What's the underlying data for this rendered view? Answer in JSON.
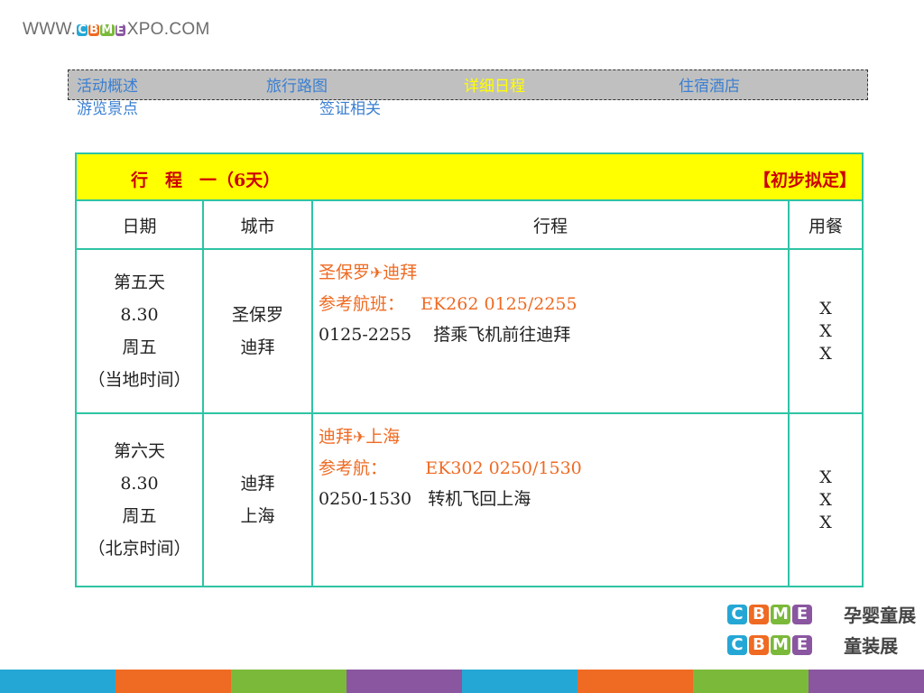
{
  "header": {
    "url_prefix": "WWW.",
    "logo_letters": [
      "C",
      "B",
      "M",
      "E"
    ],
    "url_suffix": "XPO.COM"
  },
  "nav": {
    "items": [
      {
        "label": "活动概述",
        "active": false
      },
      {
        "label": "旅行路图",
        "active": false
      },
      {
        "label": "详细日程",
        "active": true
      },
      {
        "label": "住宿酒店",
        "active": false
      },
      {
        "label": "游览景点",
        "active": false
      },
      {
        "label": "签证相关",
        "active": false
      }
    ]
  },
  "schedule": {
    "title": "行　程　一（6天）",
    "tag": "【初步拟定】",
    "columns": [
      "日期",
      "城市",
      "行程",
      "用餐"
    ],
    "rows": [
      {
        "date_lines": [
          "第五天",
          "8.30",
          "周五",
          "（当地时间）"
        ],
        "city_lines": [
          "圣保罗",
          "迪拜"
        ],
        "route_from": "圣保罗",
        "route_to": "迪拜",
        "flight": "参考航班：   EK262 0125/2255",
        "detail": "0125-2255    搭乘飞机前往迪拜",
        "meals": [
          "X",
          "X",
          "X"
        ]
      },
      {
        "date_lines": [
          "第六天",
          "8.30",
          "周五",
          "（北京时间）"
        ],
        "city_lines": [
          "迪拜",
          "上海"
        ],
        "route_from": "迪拜",
        "route_to": "上海",
        "flight": "参考航：       EK302 0250/1530",
        "detail": "0250-1530   转机飞回上海",
        "meals": [
          "X",
          "X",
          "X"
        ]
      }
    ]
  },
  "brand": {
    "letters": [
      "C",
      "B",
      "M",
      "E"
    ],
    "line1": "孕婴童展",
    "line2": "童装展",
    "reg_mark": "®"
  },
  "colors": {
    "logo": [
      "#25a7d5",
      "#ef6a22",
      "#7bb93a",
      "#8a56a0"
    ],
    "stripes": [
      "#25a7d5",
      "#ef6a22",
      "#7bb93a",
      "#8a56a0",
      "#25a7d5",
      "#ef6a22",
      "#7bb93a",
      "#8a56a0"
    ]
  },
  "icons": {
    "plane": "airplane-icon"
  }
}
